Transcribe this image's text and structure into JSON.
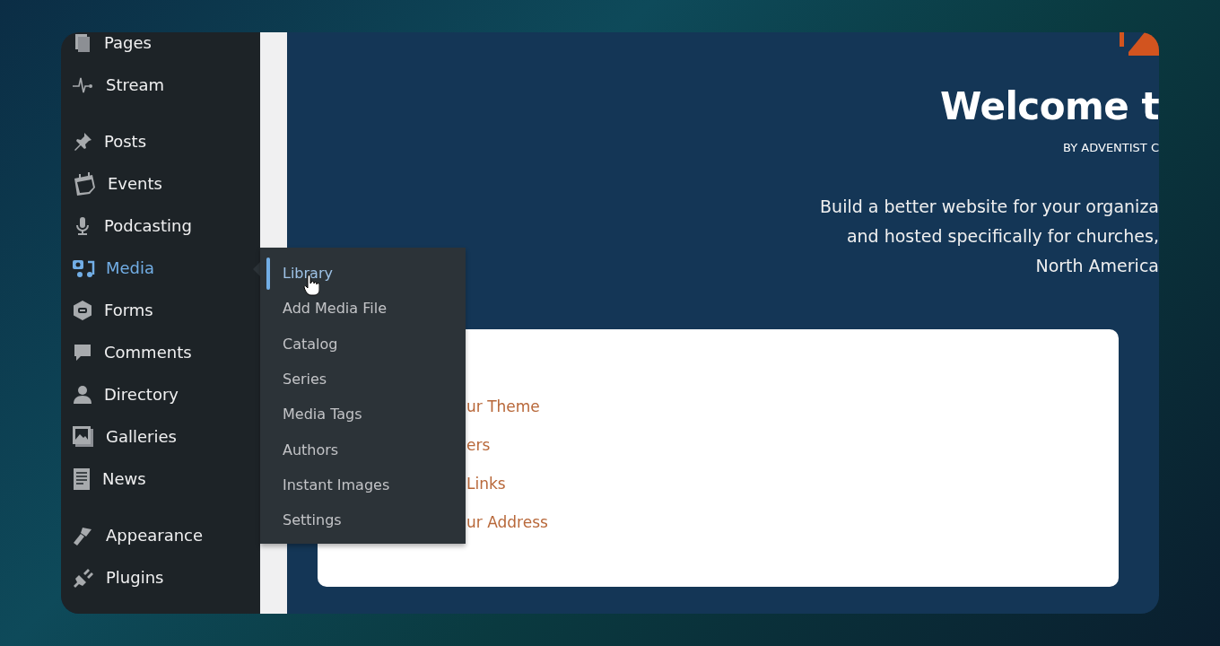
{
  "sidebar": {
    "groups": [
      [
        {
          "label": "Pages",
          "selected": false
        },
        {
          "label": "Stream",
          "selected": false
        }
      ],
      [
        {
          "label": "Posts",
          "selected": false
        },
        {
          "label": "Events",
          "selected": false
        },
        {
          "label": "Podcasting",
          "selected": false
        },
        {
          "label": "Media",
          "selected": true
        },
        {
          "label": "Forms",
          "selected": false
        },
        {
          "label": "Comments",
          "selected": false
        },
        {
          "label": "Directory",
          "selected": false
        },
        {
          "label": "Galleries",
          "selected": false
        },
        {
          "label": "News",
          "selected": false
        }
      ],
      [
        {
          "label": "Appearance",
          "selected": false
        },
        {
          "label": "Plugins",
          "selected": false
        }
      ]
    ]
  },
  "flyout": {
    "items": [
      {
        "label": "Library",
        "selected": true
      },
      {
        "label": "Add Media File",
        "selected": false
      },
      {
        "label": "Catalog",
        "selected": false
      },
      {
        "label": "Series",
        "selected": false
      },
      {
        "label": "Media Tags",
        "selected": false
      },
      {
        "label": "Authors",
        "selected": false
      },
      {
        "label": "Instant Images",
        "selected": false
      },
      {
        "label": "Settings",
        "selected": false
      }
    ]
  },
  "welcome": {
    "title": "Welcome t",
    "byline": "BY ADVENTIST C",
    "description": [
      "Build a better website for your organiza",
      "and hosted specifically for churches,",
      "North America"
    ]
  },
  "card": {
    "links": [
      "ur Theme",
      "ers",
      "Links",
      "ur Address"
    ]
  }
}
